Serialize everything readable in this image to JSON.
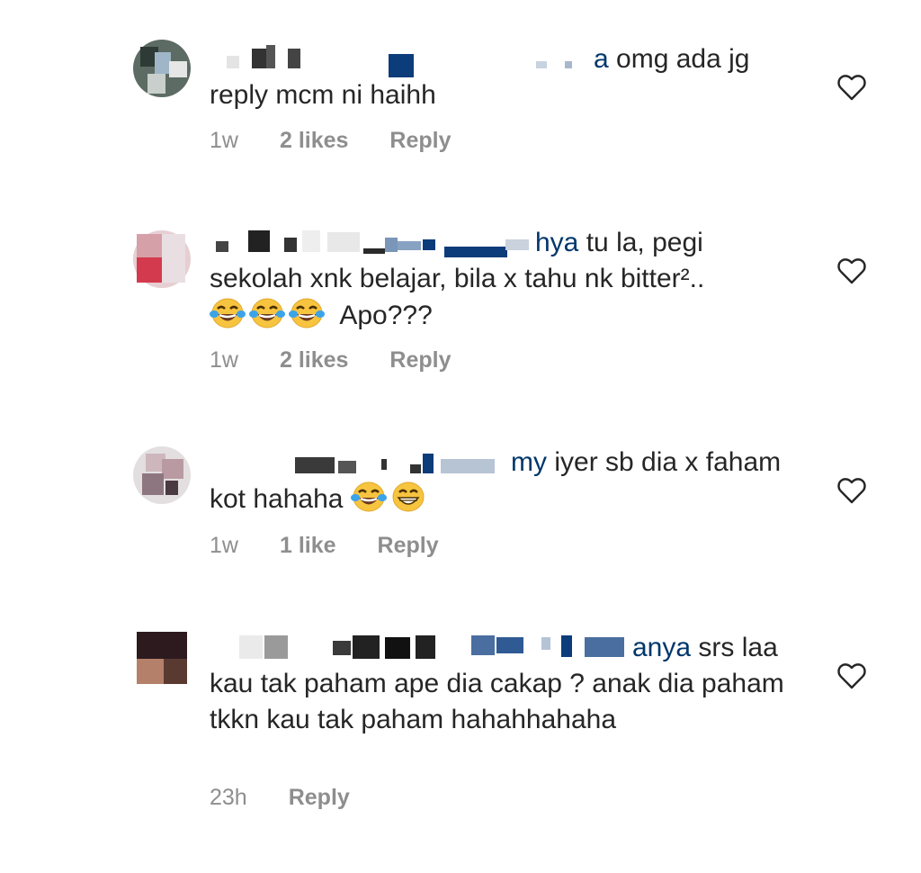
{
  "comments": [
    {
      "mention_suffix": "a",
      "text": "omg ada jg reply mcm ni haihh",
      "time": "1w",
      "likes": "2 likes",
      "reply": "Reply"
    },
    {
      "mention_suffix": "hya",
      "text_line1": "tu la, pegi sekolah xnk belajar, bila x tahu nk bitter²..",
      "text_line2": "Apo???",
      "time": "1w",
      "likes": "2 likes",
      "reply": "Reply"
    },
    {
      "mention_suffix": "my",
      "text": "iyer sb dia x faham kot hahaha",
      "time": "1w",
      "likes": "1 like",
      "reply": "Reply"
    },
    {
      "mention_suffix": "anya",
      "text": "srs laa kau tak paham ape dia cakap ? anak dia paham tkkn kau tak paham hahahhahaha",
      "time": "23h",
      "reply": "Reply"
    }
  ],
  "icons": {
    "heart": "heart-outline-icon",
    "emoji_laugh": "tears-of-joy-emoji",
    "emoji_grin": "grinning-emoji"
  },
  "colors": {
    "text": "#262626",
    "meta": "#8e8e8e",
    "mention": "#00376b"
  }
}
